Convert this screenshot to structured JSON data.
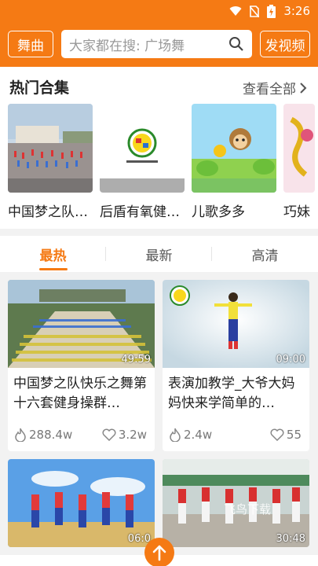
{
  "status": {
    "time": "3:26"
  },
  "header": {
    "dance_button": "舞曲",
    "search_placeholder": "大家都在搜: 广场舞",
    "post_button": "发视频"
  },
  "hot_collections": {
    "title": "热门合集",
    "view_all": "查看全部",
    "items": [
      {
        "label": "中国梦之队…"
      },
      {
        "label": "后盾有氧健…"
      },
      {
        "label": "儿歌多多"
      },
      {
        "label": "巧妹"
      }
    ]
  },
  "tabs": [
    {
      "label": "最热"
    },
    {
      "label": "最新"
    },
    {
      "label": "高清"
    }
  ],
  "videos": [
    {
      "title": "中国梦之队快乐之舞第十六套健身操群…",
      "duration": "49:59",
      "plays": "288.4w",
      "likes": "3.2w"
    },
    {
      "title": "表演加教学_大爷大妈妈快来学简单的…",
      "duration": "09:00",
      "plays": "2.4w",
      "likes": "55"
    },
    {
      "title": "",
      "duration": "06:0",
      "plays": "",
      "likes": ""
    },
    {
      "title": "",
      "duration": "30:48",
      "plays": "",
      "likes": ""
    }
  ],
  "watermark": "飞鸟下载",
  "colors": {
    "accent": "#f57a14"
  }
}
